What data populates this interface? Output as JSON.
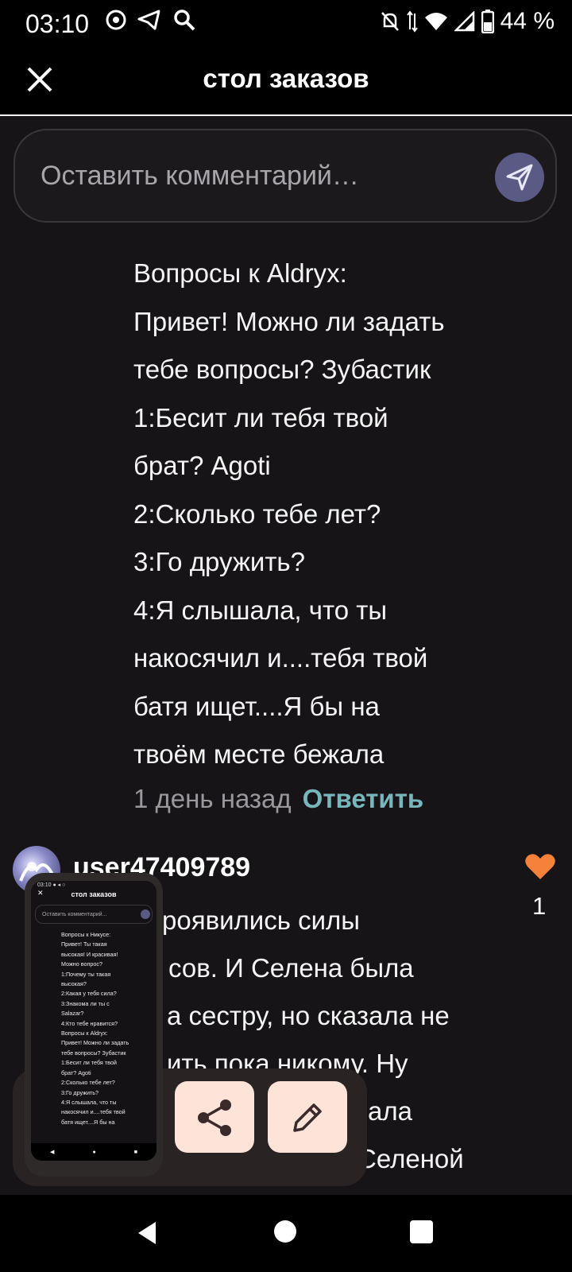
{
  "status_bar": {
    "time": "03:10",
    "battery": "44 %",
    "left_icons": [
      "chrome-icon",
      "telegram-icon",
      "search-icon"
    ],
    "right_icons": [
      "mute-icon",
      "data-arrows-icon",
      "wifi-icon",
      "signal-icon",
      "battery-icon"
    ]
  },
  "header": {
    "title": "стол заказов",
    "close_icon": "close-icon"
  },
  "comment_input": {
    "placeholder": "Оставить комментарий…",
    "send_icon": "send-icon",
    "send_color": "#5b5a85"
  },
  "comment1": {
    "lines": [
      "Вопросы к Aldryx:",
      "Привет! Можно ли задать",
      "тебе вопросы? Зубастик",
      "1:Бесит ли тебя твой",
      "брат? Agoti",
      "2:Сколько тебе лет?",
      "3:Го дружить?",
      "4:Я слышала, что ты",
      "накосячил и....тебя твой",
      "батя ищет....Я бы на",
      "твоём месте бежала"
    ],
    "time": "1 день назад",
    "reply_label": "Ответить",
    "reply_color": "#78b6bc"
  },
  "comment2": {
    "username": "user47409789",
    "likes": "1",
    "like_color": "#f5813b",
    "partial_lines": [
      "роявились силы",
      "сов. И Селена была",
      "а сестру, но сказала не",
      "ить пока никому. Ну",
      "ала",
      "Селеной"
    ]
  },
  "mini_screenshot": {
    "title": "стол заказов",
    "placeholder": "Оставить комментарий...",
    "status": "03:10 ● ◂ ○",
    "lines": [
      "Вопросы к Никусе:",
      "Привет! Ты такая",
      "высокая! И красивая!",
      "Можно вопрос?",
      "1:Почему ты такая",
      "высокая?",
      "2:Какая у тебя сила?",
      "3:Знакома ли ты с",
      "Salazar?",
      "4:Кто тебе нравится?",
      "Вопросы к Aldryx:",
      "Привет! Можно ли задать",
      "тебе вопросы? Зубастик",
      "1:Бесит ли тебя твой",
      "брат? Agoti",
      "2:Сколько тебе лет?",
      "3:Го дружить?",
      "4:Я слышала, что ты",
      "накосячил и....тебя твой",
      "батя ищет....Я бы на"
    ]
  },
  "actions": {
    "share_icon": "share-icon",
    "edit_icon": "pencil-icon",
    "button_color": "#fde3d8"
  }
}
